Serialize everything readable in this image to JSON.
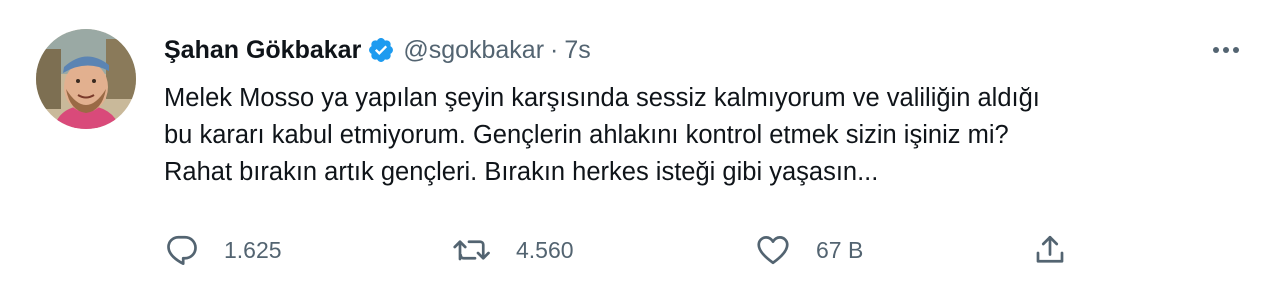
{
  "user": {
    "name": "Şahan Gökbakar",
    "handle": "@sgokbakar",
    "separator": "·",
    "time": "7s",
    "verified_color": "#1d9bf0"
  },
  "tweet": {
    "lines": [
      "Melek Mosso ya yapılan şeyin karşısında sessiz kalmıyorum ve valiliğin aldığı",
      "bu kararı kabul etmiyorum. Gençlerin ahlakını kontrol etmek sizin işiniz mi?",
      "Rahat bırakın artık gençleri. Bırakın herkes isteği gibi yaşasın..."
    ]
  },
  "actions": {
    "reply": {
      "icon": "reply-icon",
      "count": "1.625"
    },
    "retweet": {
      "icon": "retweet-icon",
      "count": "4.560"
    },
    "like": {
      "icon": "heart-icon",
      "count": "67 B"
    },
    "share": {
      "icon": "share-icon"
    }
  },
  "colors": {
    "text": "#0f1419",
    "secondary": "#536471",
    "accent": "#1d9bf0"
  }
}
